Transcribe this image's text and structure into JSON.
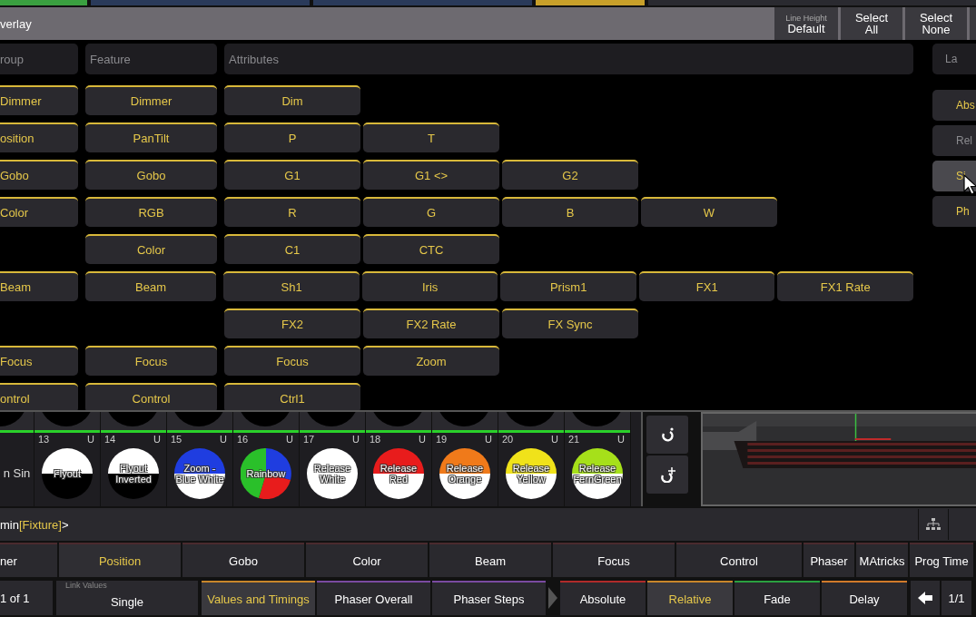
{
  "title_bar": {
    "title": "verlay",
    "line_height": {
      "label": "Line Height",
      "value": "Default"
    },
    "buttons": [
      "Select All",
      "Select None"
    ]
  },
  "columns": [
    "roup",
    "Feature",
    "Attributes"
  ],
  "rows": [
    {
      "group": "Dimmer",
      "feature": "Dimmer",
      "attributes": [
        "Dim"
      ]
    },
    {
      "group": "osition",
      "feature": "PanTilt",
      "attributes": [
        "P",
        "T"
      ]
    },
    {
      "group": "Gobo",
      "feature": "Gobo",
      "attributes": [
        "G1",
        "G1 <>",
        "G2"
      ]
    },
    {
      "group": "Color",
      "feature": "RGB",
      "attributes": [
        "R",
        "G",
        "B",
        "W"
      ]
    },
    {
      "feature": "Color",
      "attributes": [
        "C1",
        "CTC"
      ]
    },
    {
      "group": "Beam",
      "feature": "Beam",
      "attributes": [
        "Sh1",
        "Iris",
        "Prism1",
        "FX1",
        "FX1 Rate"
      ]
    },
    {
      "attributes": [
        "FX2",
        "FX2 Rate",
        "FX Sync"
      ]
    },
    {
      "group": "Focus",
      "feature": "Focus",
      "attributes": [
        "Focus",
        "Zoom"
      ]
    },
    {
      "group": "ontrol",
      "feature": "Control",
      "attributes": [
        "Ctrl1"
      ]
    }
  ],
  "side_panel": {
    "header": "La",
    "buttons": [
      {
        "label": "Abs",
        "active": true,
        "selected": false
      },
      {
        "label": "Rel",
        "active": false,
        "selected": false
      },
      {
        "label": "Si",
        "active": true,
        "selected": true
      },
      {
        "label": "Ph",
        "active": true,
        "selected": false
      }
    ]
  },
  "pool": [
    {
      "label": "n Sin",
      "kind": "partial"
    },
    {
      "number": "13",
      "flag": "U",
      "label": "Flyout",
      "kind": "over_black",
      "color": "#ffffff"
    },
    {
      "number": "14",
      "flag": "U",
      "label": "Flyout Inverted",
      "kind": "over_black",
      "color": "#ffffff"
    },
    {
      "number": "15",
      "flag": "U",
      "label": "Zoom - Blue White",
      "kind": "over_white",
      "color": "#1f3de0"
    },
    {
      "number": "16",
      "flag": "U",
      "label": "Rainbow",
      "kind": "rainbow"
    },
    {
      "number": "17",
      "flag": "U",
      "label": "Release White",
      "kind": "over_white",
      "color": "#ffffff"
    },
    {
      "number": "18",
      "flag": "U",
      "label": "Release Red",
      "kind": "over_white",
      "color": "#e81c1c"
    },
    {
      "number": "19",
      "flag": "U",
      "label": "Release Orange",
      "kind": "over_white",
      "color": "#f07a1a"
    },
    {
      "number": "20",
      "flag": "U",
      "label": "Release Yellow",
      "kind": "over_white",
      "color": "#f0e21a"
    },
    {
      "number": "21",
      "flag": "U",
      "label": "Release FernGreen",
      "kind": "over_white",
      "color": "#a6e01a"
    }
  ],
  "command_line": [
    {
      "kind": "plain",
      "text": "min"
    },
    {
      "kind": "object",
      "text": "[Fixture]"
    },
    {
      "kind": "plain",
      "text": ">"
    }
  ],
  "preset_tabs": [
    {
      "label": "ner",
      "selected": false
    },
    {
      "label": "Position",
      "selected": true
    },
    {
      "label": "Gobo",
      "selected": false
    },
    {
      "label": "Color",
      "selected": false
    },
    {
      "label": "Beam",
      "selected": false
    },
    {
      "label": "Focus",
      "selected": false
    },
    {
      "label": "Control",
      "selected": false
    },
    {
      "label": "Phaser",
      "selected": false,
      "kind": "small"
    },
    {
      "label": "MAtricks",
      "selected": false,
      "kind": "small"
    },
    {
      "label": "Prog Time",
      "selected": false,
      "kind": "small"
    }
  ],
  "bottom_bar": {
    "page": "1 of 1",
    "link_values": {
      "label": "Link Values",
      "value": "Single"
    },
    "modes": [
      {
        "label": "Values and Timings",
        "selected": true,
        "color": "#c8862a"
      },
      {
        "label": "Phaser Overall",
        "selected": false,
        "color": "#7a4aa0"
      },
      {
        "label": "Phaser Steps",
        "selected": false,
        "color": "#7a4aa0"
      }
    ],
    "layers": [
      {
        "label": "Absolute",
        "selected": false,
        "color": "#b02a2a"
      },
      {
        "label": "Relative",
        "selected": true,
        "color": "#c8862a"
      },
      {
        "label": "Fade",
        "selected": false,
        "color": "#2aa040"
      },
      {
        "label": "Delay",
        "selected": false,
        "color": "#d07a2a"
      }
    ],
    "page_nav": "1/1"
  }
}
